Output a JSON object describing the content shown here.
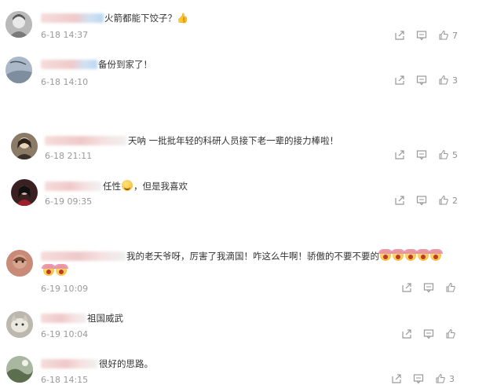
{
  "comments": [
    {
      "text": "火箭都能下饺子？",
      "emoji": "👍",
      "time": "6-18 14:37",
      "likes": "7"
    },
    {
      "text": "备份到家了！",
      "time": "6-18 14:10",
      "likes": "3"
    },
    {
      "text": "天呐 一批批年轻的科研人员接下老一辈的接力棒啦！",
      "time": "6-18 21:11",
      "likes": "5"
    },
    {
      "text_a": "任性",
      "text_b": "，但是我喜欢",
      "time": "6-19 09:35",
      "likes": "2"
    },
    {
      "text": "我的老天爷呀，厉害了我滴国！咋这么牛啊！骄傲的不要不要的",
      "time": "6-19 10:09",
      "likes": ""
    },
    {
      "text": "祖国威武",
      "time": "6-19 10:04",
      "likes": ""
    },
    {
      "text": "很好的思路。",
      "time": "6-18 14:15",
      "likes": "3"
    }
  ],
  "icons": {
    "share": "share-icon",
    "comment": "comment-icon",
    "like": "thumbs-up-icon"
  }
}
